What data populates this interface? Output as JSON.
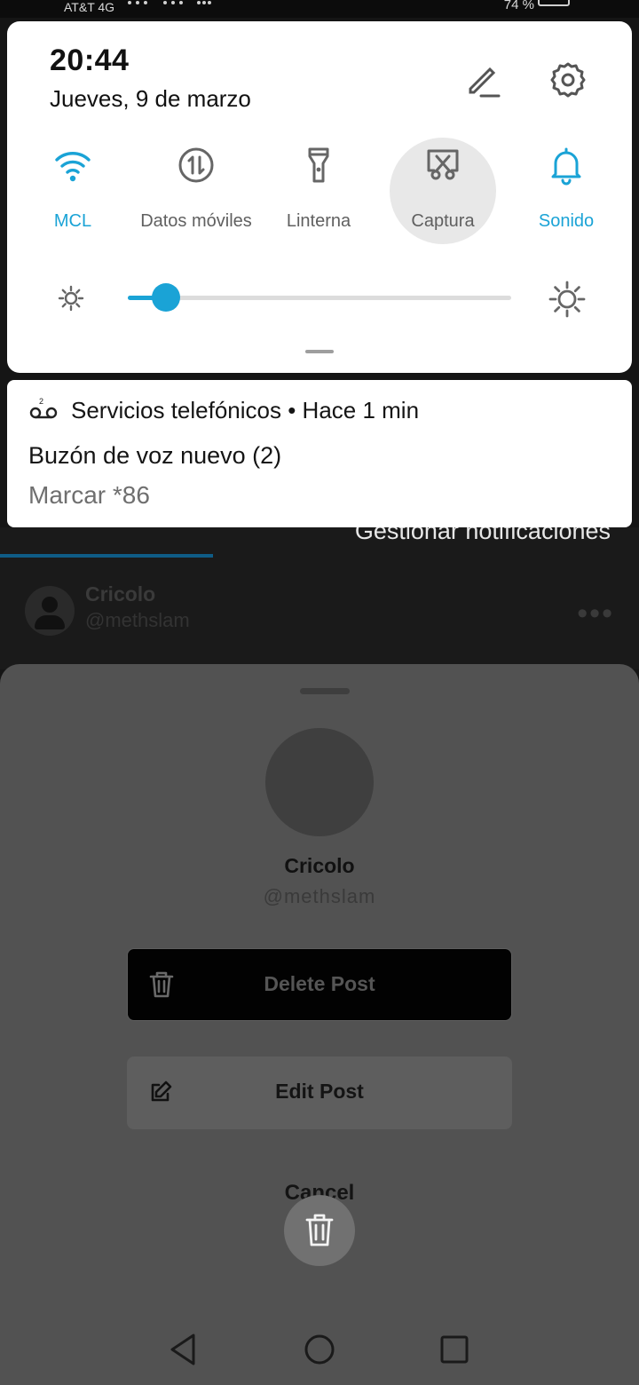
{
  "status_bar": {
    "carrier": "AT&T 4G",
    "battery": "74 %"
  },
  "quick_settings": {
    "time": "20:44",
    "date": "Jueves, 9 de marzo",
    "tiles": [
      {
        "label": "MCL",
        "icon": "wifi-icon",
        "active": true
      },
      {
        "label": "Datos móviles",
        "icon": "mobile-data-icon",
        "active": false
      },
      {
        "label": "Linterna",
        "icon": "flashlight-icon",
        "active": false
      },
      {
        "label": "Captura",
        "icon": "screenshot-icon",
        "active": false
      },
      {
        "label": "Sonido",
        "icon": "bell-icon",
        "active": true
      }
    ],
    "brightness": 0.1,
    "accent_color": "#1aa3d6"
  },
  "notification": {
    "badge": "2",
    "source": "Servicios telefónicos • Hace 1 min",
    "title": "Buzón de voz nuevo (2)",
    "body": "Marcar *86"
  },
  "background_app": {
    "manage_label": "Gestionar notificaciones",
    "author_name": "Cricolo",
    "author_handle": "@methslam"
  },
  "sheet": {
    "name": "Cricolo",
    "handle": "@methslam",
    "delete_label": "Delete Post",
    "edit_label": "Edit Post",
    "cancel_label": "Cancel"
  }
}
